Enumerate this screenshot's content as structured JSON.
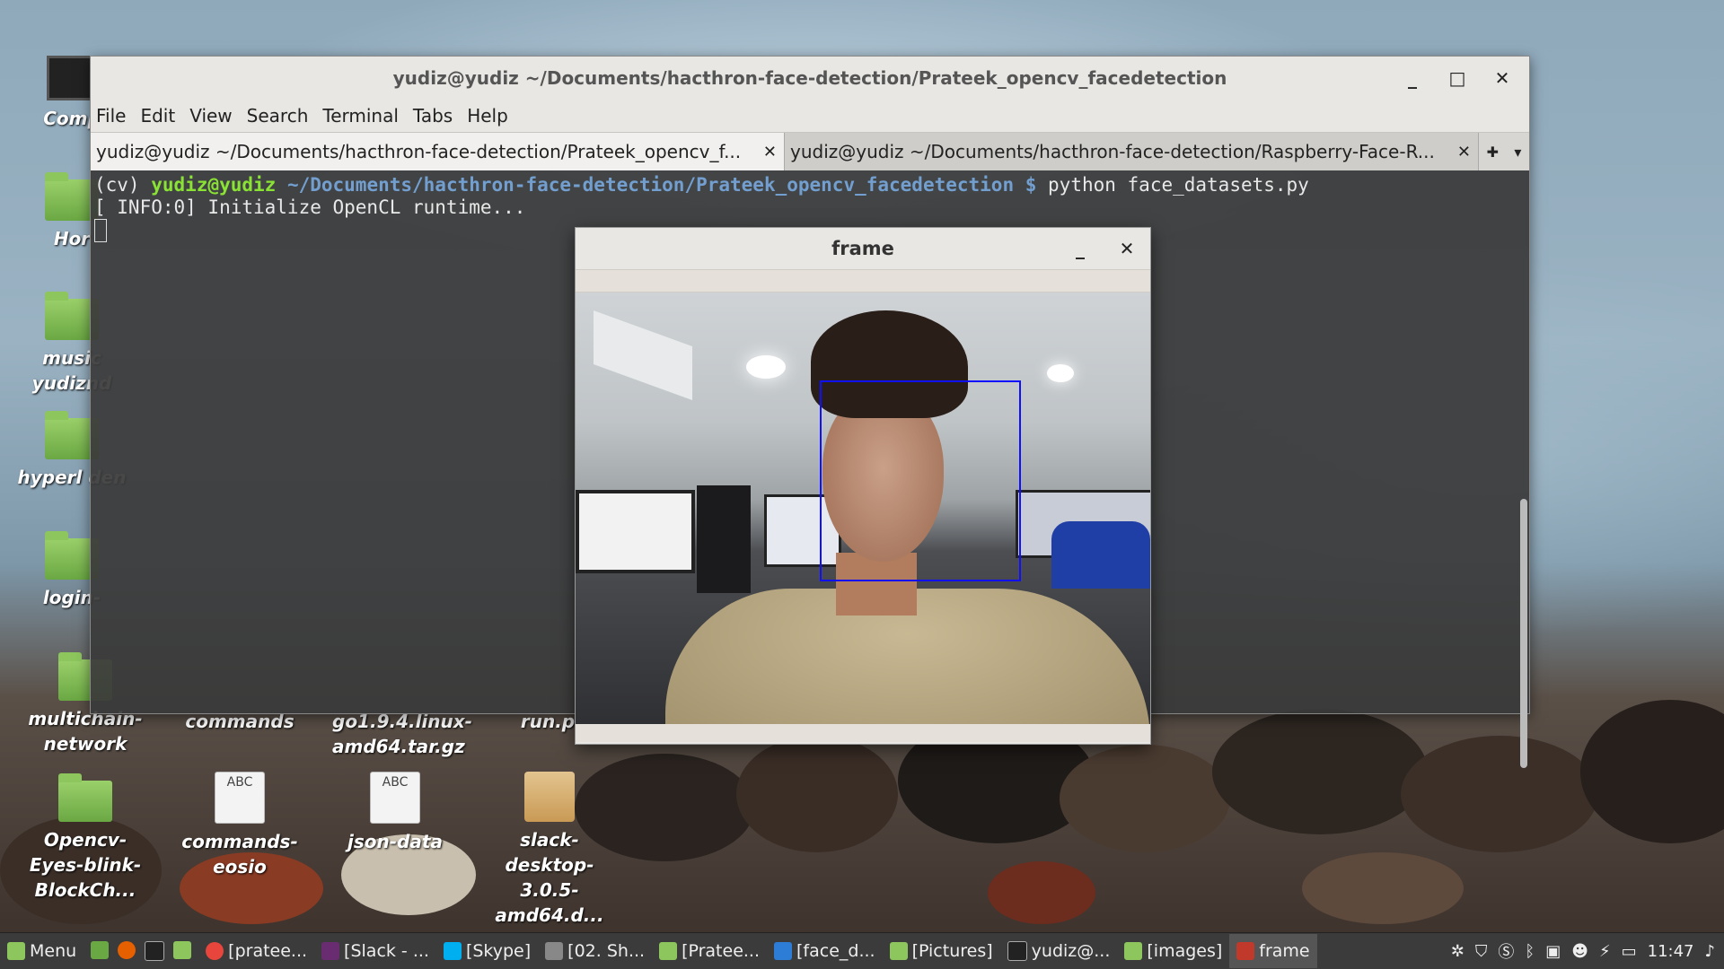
{
  "desktop_icons": [
    {
      "label": "Comp",
      "type": "monitor"
    },
    {
      "label": "Hor",
      "type": "home"
    },
    {
      "label": "music yudiznd",
      "type": "folder"
    },
    {
      "label": "hyperl den",
      "type": "folder"
    },
    {
      "label": "login-",
      "type": "folder"
    },
    {
      "label": "multichain-network",
      "type": "folder"
    },
    {
      "label": "commands",
      "type": "doc"
    },
    {
      "label": "go1.9.4.linux-amd64.tar.gz",
      "type": "archive"
    },
    {
      "label": "run.p",
      "type": "doc"
    },
    {
      "label": "Opencv-Eyes-blink-BlockCh...",
      "type": "folder"
    },
    {
      "label": "commands-eosio",
      "type": "doc"
    },
    {
      "label": "json-data",
      "type": "doc"
    },
    {
      "label": "slack-desktop-3.0.5-amd64.d...",
      "type": "package"
    }
  ],
  "terminal": {
    "title": "yudiz@yudiz ~/Documents/hacthron-face-detection/Prateek_opencv_facedetection",
    "menu": [
      "File",
      "Edit",
      "View",
      "Search",
      "Terminal",
      "Tabs",
      "Help"
    ],
    "tabs": [
      {
        "label": "yudiz@yudiz ~/Documents/hacthron-face-detection/Prateek_opencv_f...",
        "active": true
      },
      {
        "label": "yudiz@yudiz ~/Documents/hacthron-face-detection/Raspberry-Face-R...",
        "active": false
      }
    ],
    "line1_env": "(cv) ",
    "line1_user": "yudiz@yudiz",
    "line1_path": " ~/Documents/hacthron-face-detection/Prateek_opencv_facedetection $",
    "line1_cmd": " python face_datasets.py",
    "line2": "[ INFO:0] Initialize OpenCL runtime..."
  },
  "frame_window": {
    "title": "frame"
  },
  "taskbar": {
    "menu_label": "Menu",
    "items": [
      {
        "label": "[pratee...",
        "icon": "chrome-icon",
        "color": "#e8453c"
      },
      {
        "label": "[Slack - ...",
        "icon": "slack-icon",
        "color": "#6a2c70"
      },
      {
        "label": "[Skype]",
        "icon": "skype-icon",
        "color": "#00aff0"
      },
      {
        "label": "[02. Sh...",
        "icon": "video-icon",
        "color": "#888888"
      },
      {
        "label": "[Pratee...",
        "icon": "folder-icon",
        "color": "#8cc65c"
      },
      {
        "label": "[face_d...",
        "icon": "vscode-icon",
        "color": "#2d7cd6"
      },
      {
        "label": "[Pictures]",
        "icon": "folder-icon",
        "color": "#8cc65c"
      },
      {
        "label": "yudiz@...",
        "icon": "terminal-icon",
        "color": "#222222"
      },
      {
        "label": "[images]",
        "icon": "folder-icon",
        "color": "#8cc65c"
      },
      {
        "label": "frame",
        "icon": "frame-icon",
        "color": "#c0392b",
        "active": true
      }
    ],
    "clock": "11:47"
  }
}
